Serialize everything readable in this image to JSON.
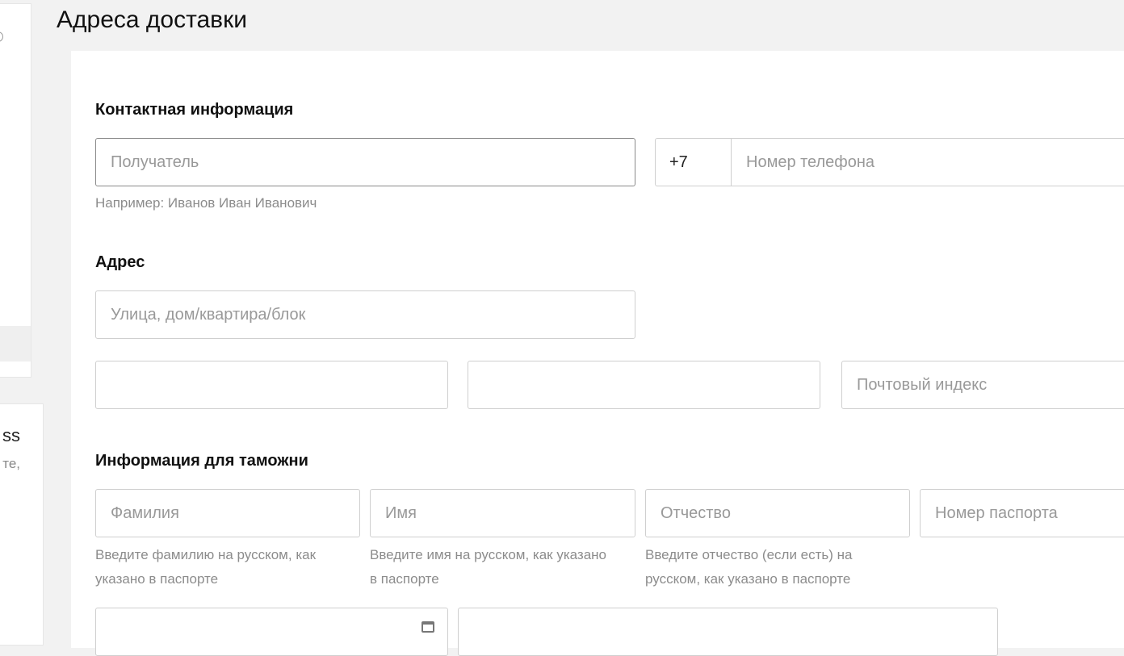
{
  "page": {
    "title": "Адреса доставки"
  },
  "sidebar": {
    "text1": "ss",
    "text2": "те,"
  },
  "contact": {
    "section_title": "Контактная информация",
    "recipient_placeholder": "Получатель",
    "recipient_hint": "Например: Иванов Иван Иванович",
    "phone_code": "+7",
    "phone_placeholder": "Номер телефона"
  },
  "address": {
    "section_title": "Адрес",
    "street_placeholder": "Улица, дом/квартира/блок",
    "field2_value": "",
    "field3_value": "",
    "postal_placeholder": "Почтовый индекс"
  },
  "customs": {
    "section_title": "Информация для таможни",
    "lastname_placeholder": "Фамилия",
    "lastname_hint_line1": "Введите фамилию на русском, как",
    "lastname_hint_line2": "указано в паспорте",
    "firstname_placeholder": "Имя",
    "firstname_hint_line1": "Введите имя на русском, как указано",
    "firstname_hint_line2": "в паспорте",
    "middlename_placeholder": "Отчество",
    "middlename_hint_line1": "Введите отчество (если есть) на",
    "middlename_hint_line2": "русском, как указано в паспорте",
    "passport_placeholder": "Номер паспорта"
  },
  "icons": {
    "collapse": "collapse-icon",
    "calendar": "calendar-icon"
  }
}
